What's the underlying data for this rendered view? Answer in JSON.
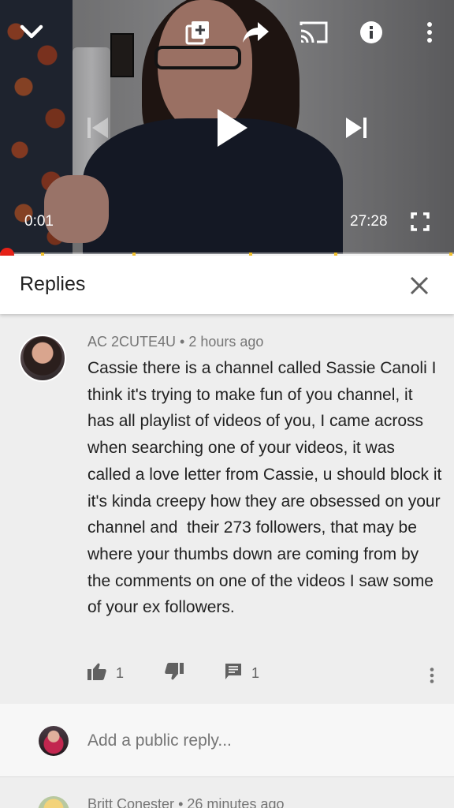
{
  "player": {
    "current_time": "0:01",
    "duration": "27:28",
    "progress_fraction": 0.0,
    "icons": {
      "collapse": "chevron-down-icon",
      "add_to_playlist": "playlist-add-icon",
      "share": "share-icon",
      "cast": "cast-icon",
      "info": "info-icon",
      "more": "more-vert-icon",
      "previous": "skip-previous-icon",
      "play": "play-icon",
      "next": "skip-next-icon",
      "fullscreen": "fullscreen-icon"
    },
    "colors": {
      "scrubber": "#e62117",
      "ad_marker": "#f2c12e"
    }
  },
  "replies_panel": {
    "title": "Replies",
    "close_icon": "close-icon"
  },
  "comment": {
    "author": "AC 2CUTE4U",
    "separator": "•",
    "time": "2 hours ago",
    "text": "Cassie there is a channel called Sassie Canoli I think it's trying to make fun of you channel, it has all playlist of videos of you, I came across when searching one of your videos, it was called a love letter from Cassie, u should block it it's kinda creepy how they are obsessed on your channel and  their 273 followers, that may be where your thumbs down are coming from by the comments on one of the videos I saw some of your ex followers.",
    "likes": "1",
    "replies": "1",
    "icons": {
      "like": "thumb-up-icon",
      "dislike": "thumb-down-icon",
      "reply": "comment-icon",
      "more": "more-vert-icon"
    }
  },
  "add_reply": {
    "placeholder": "Add a public reply..."
  },
  "next_comment": {
    "author": "Britt Conester",
    "separator": "•",
    "time": "26 minutes ago"
  }
}
